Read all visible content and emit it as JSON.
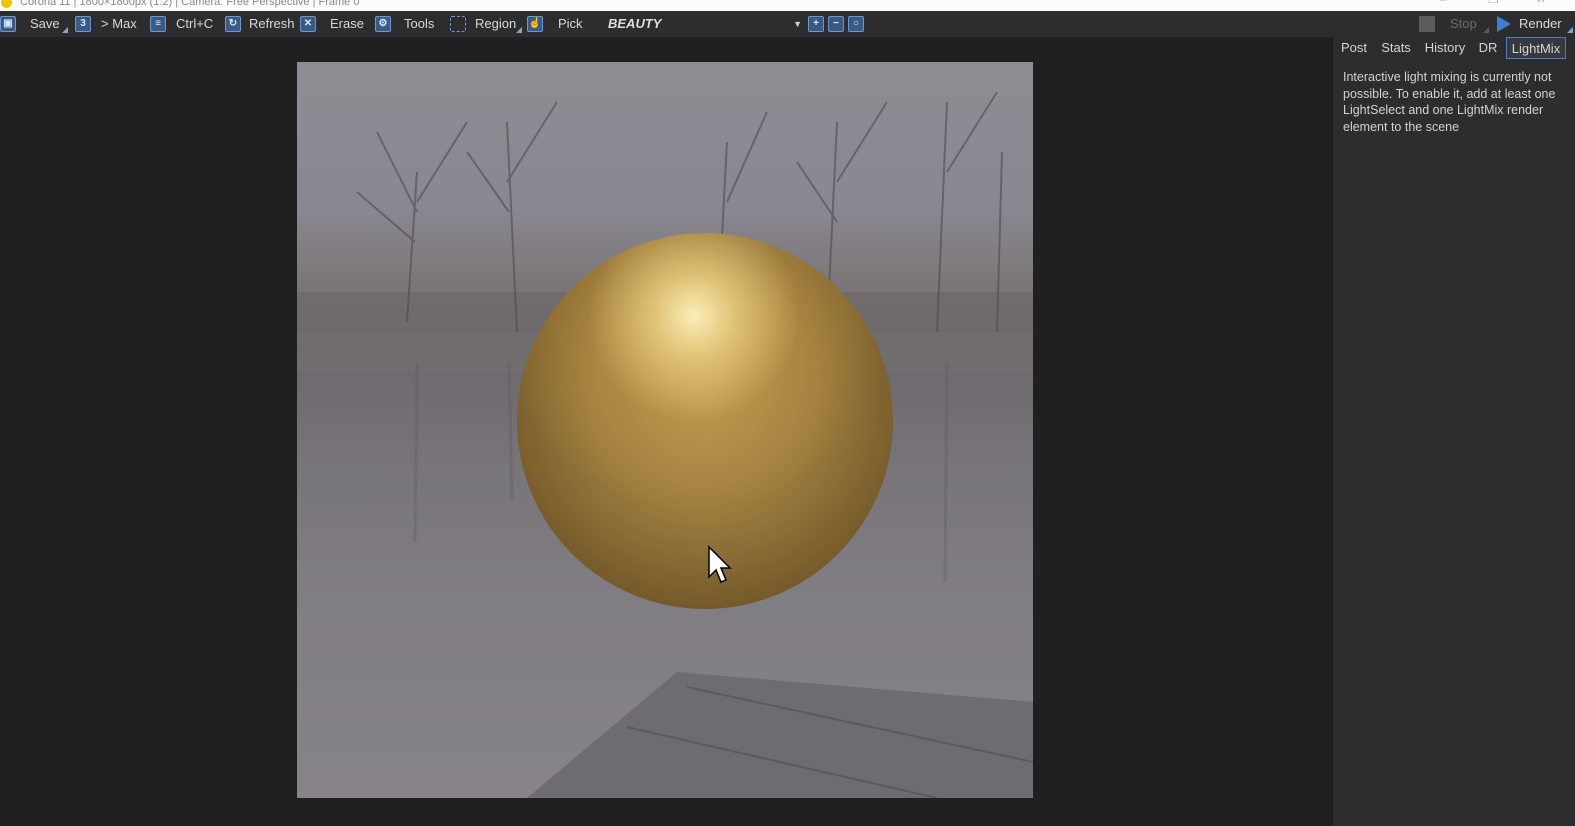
{
  "window": {
    "title": "Corona 11 | 1800×1800px (1:2) | Camera: Free Perspective | Frame 0",
    "controls": [
      "–",
      "❐",
      "✕"
    ]
  },
  "toolbar": {
    "save": "Save",
    "to_max": "> Max",
    "copy": "Ctrl+C",
    "refresh": "Refresh",
    "erase": "Erase",
    "tools": "Tools",
    "region": "Region",
    "pick": "Pick",
    "channel": "BEAUTY",
    "stop": "Stop",
    "render": "Render"
  },
  "tabs": [
    "Post",
    "Stats",
    "History",
    "DR",
    "LightMix"
  ],
  "active_tab": "LightMix",
  "panel": {
    "message": "Interactive light mixing is currently not possible. To enable it, add at least one LightSelect and one LightMix render element to the scene"
  },
  "colors": {
    "accent": "#4f7cb4",
    "background": "#252526",
    "gold": "#b89550"
  }
}
